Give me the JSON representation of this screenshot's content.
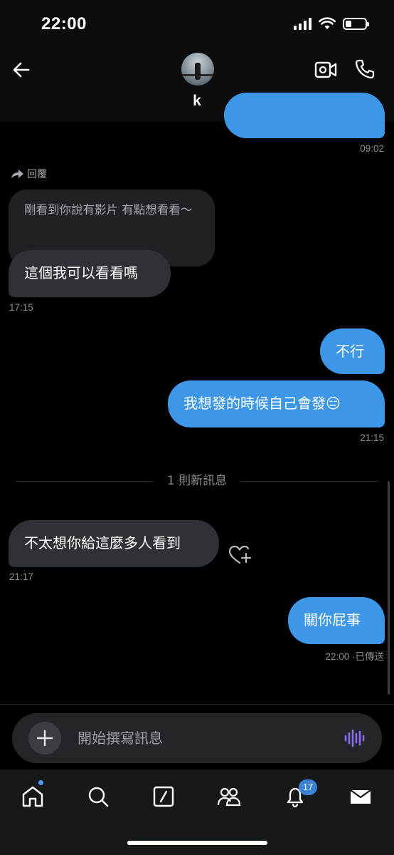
{
  "status_bar": {
    "time": "22:00"
  },
  "header": {
    "contact_name": "k"
  },
  "messages": {
    "top_partial_time": "09:02",
    "reply_label": "回覆",
    "quoted_text": "剛看到你說有影片 有點想看看～",
    "m1_text": "這個我可以看看嗎",
    "m1_time": "17:15",
    "m2_text": "不行",
    "m3_text": "我想發的時候自己會發😑",
    "m3_time": "21:15",
    "new_messages_divider": "1 則新訊息",
    "m4_text": "不太想你給這麼多人看到",
    "m4_time": "21:17",
    "m5_text": "關你屁事",
    "m5_status": "22:00 ·已傳送"
  },
  "composer": {
    "placeholder": "開始撰寫訊息"
  },
  "tabbar": {
    "notifications_badge": "17"
  },
  "colors": {
    "outgoing": "#3d97e6",
    "incoming": "#2e3135",
    "accent_voice": "#8b6cf2"
  }
}
